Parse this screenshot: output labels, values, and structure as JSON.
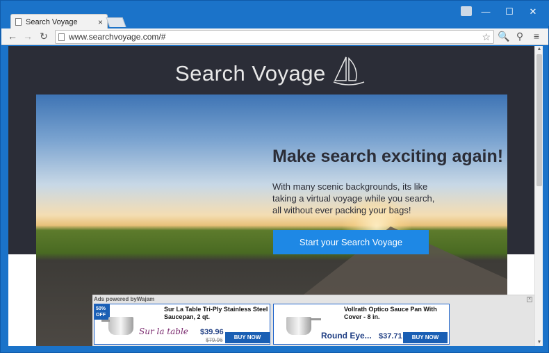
{
  "browser": {
    "tab_title": "Search Voyage",
    "tab_close": "×",
    "url": "www.searchvoyage.com/#",
    "controls": {
      "minimize": "—",
      "maximize": "☐",
      "close": "✕"
    }
  },
  "page": {
    "logo_text": "Search Voyage",
    "headline": "Make search exciting again!",
    "description": "With many scenic backgrounds, its like taking a virtual voyage while you search, all without ever packing your bags!",
    "cta_label": "Start your Search Voyage"
  },
  "ads": {
    "label": "Ads powered byWajam",
    "items": [
      {
        "badge": "50% OFF",
        "title": "Sur La Table Tri-Ply Stainless Steel Saucepan, 2 qt.",
        "brand": "Sur la table",
        "price": "$39.96",
        "old_price": "$79.96",
        "button": "BUY NOW"
      },
      {
        "title": "Vollrath Optico Sauce Pan With Cover - 8 in.",
        "brand": "Round Eye...",
        "price": "$37.71",
        "button": "BUY NOW"
      }
    ]
  },
  "colors": {
    "header_bg": "#2b2d37",
    "cta_bg": "#1e88e5",
    "window_frame": "#1b73c9"
  }
}
